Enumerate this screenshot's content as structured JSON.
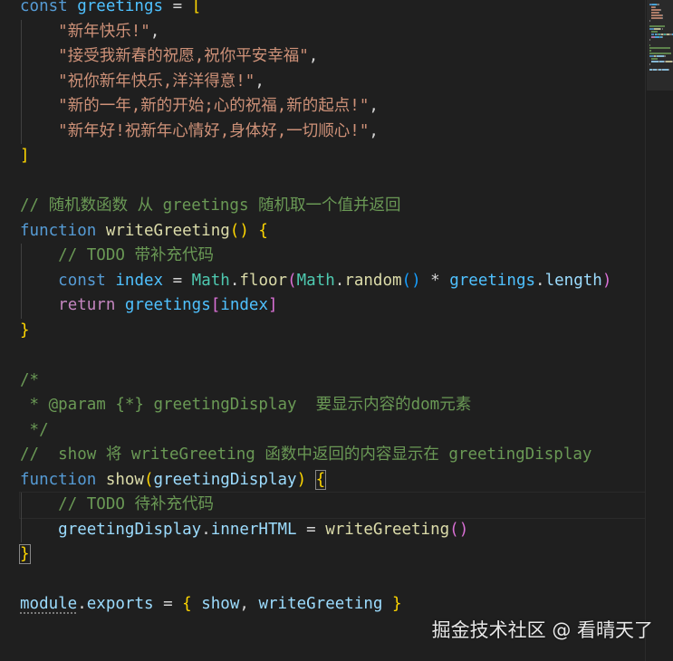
{
  "editor": {
    "lines": [
      {
        "tokens": [
          {
            "t": "const ",
            "c": "kw"
          },
          {
            "t": "greetings",
            "c": "const"
          },
          {
            "t": " = ",
            "c": "op"
          },
          {
            "t": "[",
            "c": "br1"
          }
        ]
      },
      {
        "tokens": [
          {
            "t": "    ",
            "c": "plain"
          },
          {
            "t": "\"新年快乐!\"",
            "c": "str"
          },
          {
            "t": ",",
            "c": "op"
          }
        ]
      },
      {
        "tokens": [
          {
            "t": "    ",
            "c": "plain"
          },
          {
            "t": "\"接受我新春的祝愿,祝你平安幸福\"",
            "c": "str"
          },
          {
            "t": ",",
            "c": "op"
          }
        ]
      },
      {
        "tokens": [
          {
            "t": "    ",
            "c": "plain"
          },
          {
            "t": "\"祝你新年快乐,洋洋得意!\"",
            "c": "str"
          },
          {
            "t": ",",
            "c": "op"
          }
        ]
      },
      {
        "tokens": [
          {
            "t": "    ",
            "c": "plain"
          },
          {
            "t": "\"新的一年,新的开始;心的祝福,新的起点!\"",
            "c": "str"
          },
          {
            "t": ",",
            "c": "op"
          }
        ]
      },
      {
        "tokens": [
          {
            "t": "    ",
            "c": "plain"
          },
          {
            "t": "\"新年好!祝新年心情好,身体好,一切顺心!\"",
            "c": "str"
          },
          {
            "t": ",",
            "c": "op"
          }
        ]
      },
      {
        "tokens": [
          {
            "t": "]",
            "c": "br1"
          }
        ]
      },
      {
        "tokens": []
      },
      {
        "tokens": [
          {
            "t": "// 随机数函数 从 greetings 随机取一个值并返回",
            "c": "com"
          }
        ]
      },
      {
        "tokens": [
          {
            "t": "function ",
            "c": "kw"
          },
          {
            "t": "writeGreeting",
            "c": "fn"
          },
          {
            "t": "()",
            "c": "br1"
          },
          {
            "t": " ",
            "c": "plain"
          },
          {
            "t": "{",
            "c": "br1"
          }
        ]
      },
      {
        "tokens": [
          {
            "t": "    ",
            "c": "plain"
          },
          {
            "t": "// TODO 带补充代码",
            "c": "com"
          }
        ]
      },
      {
        "tokens": [
          {
            "t": "    ",
            "c": "plain"
          },
          {
            "t": "const ",
            "c": "kw"
          },
          {
            "t": "index",
            "c": "const"
          },
          {
            "t": " = ",
            "c": "op"
          },
          {
            "t": "Math",
            "c": "cls"
          },
          {
            "t": ".",
            "c": "op"
          },
          {
            "t": "floor",
            "c": "fn"
          },
          {
            "t": "(",
            "c": "br2"
          },
          {
            "t": "Math",
            "c": "cls"
          },
          {
            "t": ".",
            "c": "op"
          },
          {
            "t": "random",
            "c": "fn"
          },
          {
            "t": "()",
            "c": "br3"
          },
          {
            "t": " * ",
            "c": "op"
          },
          {
            "t": "greetings",
            "c": "const"
          },
          {
            "t": ".",
            "c": "op"
          },
          {
            "t": "length",
            "c": "var"
          },
          {
            "t": ")",
            "c": "br2"
          }
        ]
      },
      {
        "tokens": [
          {
            "t": "    ",
            "c": "plain"
          },
          {
            "t": "return ",
            "c": "kw2"
          },
          {
            "t": "greetings",
            "c": "const"
          },
          {
            "t": "[",
            "c": "br2"
          },
          {
            "t": "index",
            "c": "const"
          },
          {
            "t": "]",
            "c": "br2"
          }
        ]
      },
      {
        "tokens": [
          {
            "t": "}",
            "c": "br1"
          }
        ]
      },
      {
        "tokens": []
      },
      {
        "tokens": [
          {
            "t": "/*",
            "c": "com"
          }
        ]
      },
      {
        "tokens": [
          {
            "t": " * @param {*} greetingDisplay  要显示内容的dom元素",
            "c": "com"
          }
        ]
      },
      {
        "tokens": [
          {
            "t": " */",
            "c": "com"
          }
        ]
      },
      {
        "tokens": [
          {
            "t": "//  show 将 writeGreeting 函数中返回的内容显示在 greetingDisplay",
            "c": "com"
          }
        ]
      },
      {
        "tokens": [
          {
            "t": "function ",
            "c": "kw"
          },
          {
            "t": "show",
            "c": "fn"
          },
          {
            "t": "(",
            "c": "br1"
          },
          {
            "t": "greetingDisplay",
            "c": "var"
          },
          {
            "t": ")",
            "c": "br1"
          },
          {
            "t": " ",
            "c": "plain"
          },
          {
            "t": "{",
            "c": "br1",
            "m": true
          }
        ]
      },
      {
        "tokens": [
          {
            "t": "    ",
            "c": "plain"
          },
          {
            "t": "// TODO 待补充代码",
            "c": "com"
          }
        ],
        "current": true
      },
      {
        "tokens": [
          {
            "t": "    ",
            "c": "plain"
          },
          {
            "t": "greetingDisplay",
            "c": "var"
          },
          {
            "t": ".",
            "c": "op"
          },
          {
            "t": "innerHTML",
            "c": "var"
          },
          {
            "t": " = ",
            "c": "op"
          },
          {
            "t": "writeGreeting",
            "c": "fn"
          },
          {
            "t": "()",
            "c": "br2"
          }
        ]
      },
      {
        "tokens": [
          {
            "t": "}",
            "c": "br1",
            "m": true
          }
        ]
      },
      {
        "tokens": []
      },
      {
        "tokens": [
          {
            "t": "module",
            "c": "var",
            "u": true
          },
          {
            "t": ".",
            "c": "op"
          },
          {
            "t": "exports",
            "c": "var"
          },
          {
            "t": " = ",
            "c": "op"
          },
          {
            "t": "{",
            "c": "br1"
          },
          {
            "t": " ",
            "c": "plain"
          },
          {
            "t": "show",
            "c": "var"
          },
          {
            "t": ", ",
            "c": "op"
          },
          {
            "t": "writeGreeting",
            "c": "var"
          },
          {
            "t": " ",
            "c": "plain"
          },
          {
            "t": "}",
            "c": "br1"
          }
        ]
      }
    ]
  },
  "watermark": "掘金技术社区 @ 看晴天了",
  "colors": {
    "background": "#1f1f1f",
    "keyword": "#569cd6",
    "string": "#ce9178",
    "comment": "#6a9955",
    "function": "#dcdcaa"
  }
}
